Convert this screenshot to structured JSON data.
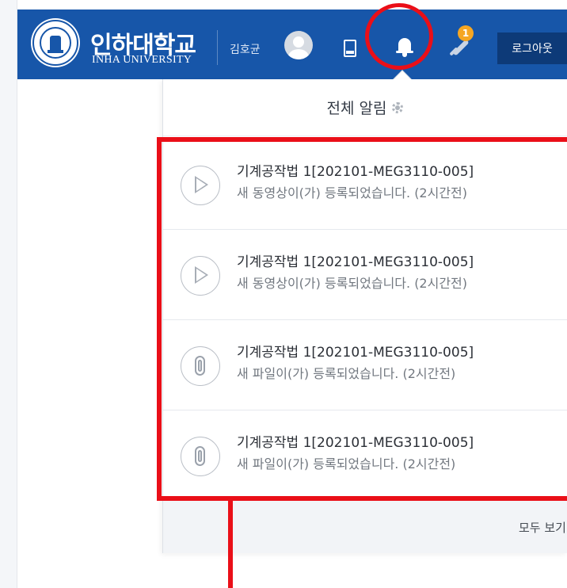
{
  "header": {
    "logo_kr": "인하대학교",
    "logo_en": "INHA UNIVERSITY",
    "user_name": "김호균",
    "notification_count": "1",
    "logout_label": "로그아웃",
    "brand_color": "#1756a9"
  },
  "notifications": {
    "title": "전체 알림",
    "items": [
      {
        "type": "video-play-icon",
        "course": "기계공작법 1[202101-MEG3110-005]",
        "message": "새 동영상이(가) 등록되었습니다. (2시간전)"
      },
      {
        "type": "video-play-icon",
        "course": "기계공작법 1[202101-MEG3110-005]",
        "message": "새 동영상이(가) 등록되었습니다. (2시간전)"
      },
      {
        "type": "paperclip-icon",
        "course": "기계공작법 1[202101-MEG3110-005]",
        "message": "새 파일이(가) 등록되었습니다. (2시간전)"
      },
      {
        "type": "paperclip-icon",
        "course": "기계공작법 1[202101-MEG3110-005]",
        "message": "새 파일이(가) 등록되었습니다. (2시간전)"
      }
    ],
    "see_all_label": "모두 보기"
  },
  "annotation": {
    "color": "#ea0f18"
  }
}
